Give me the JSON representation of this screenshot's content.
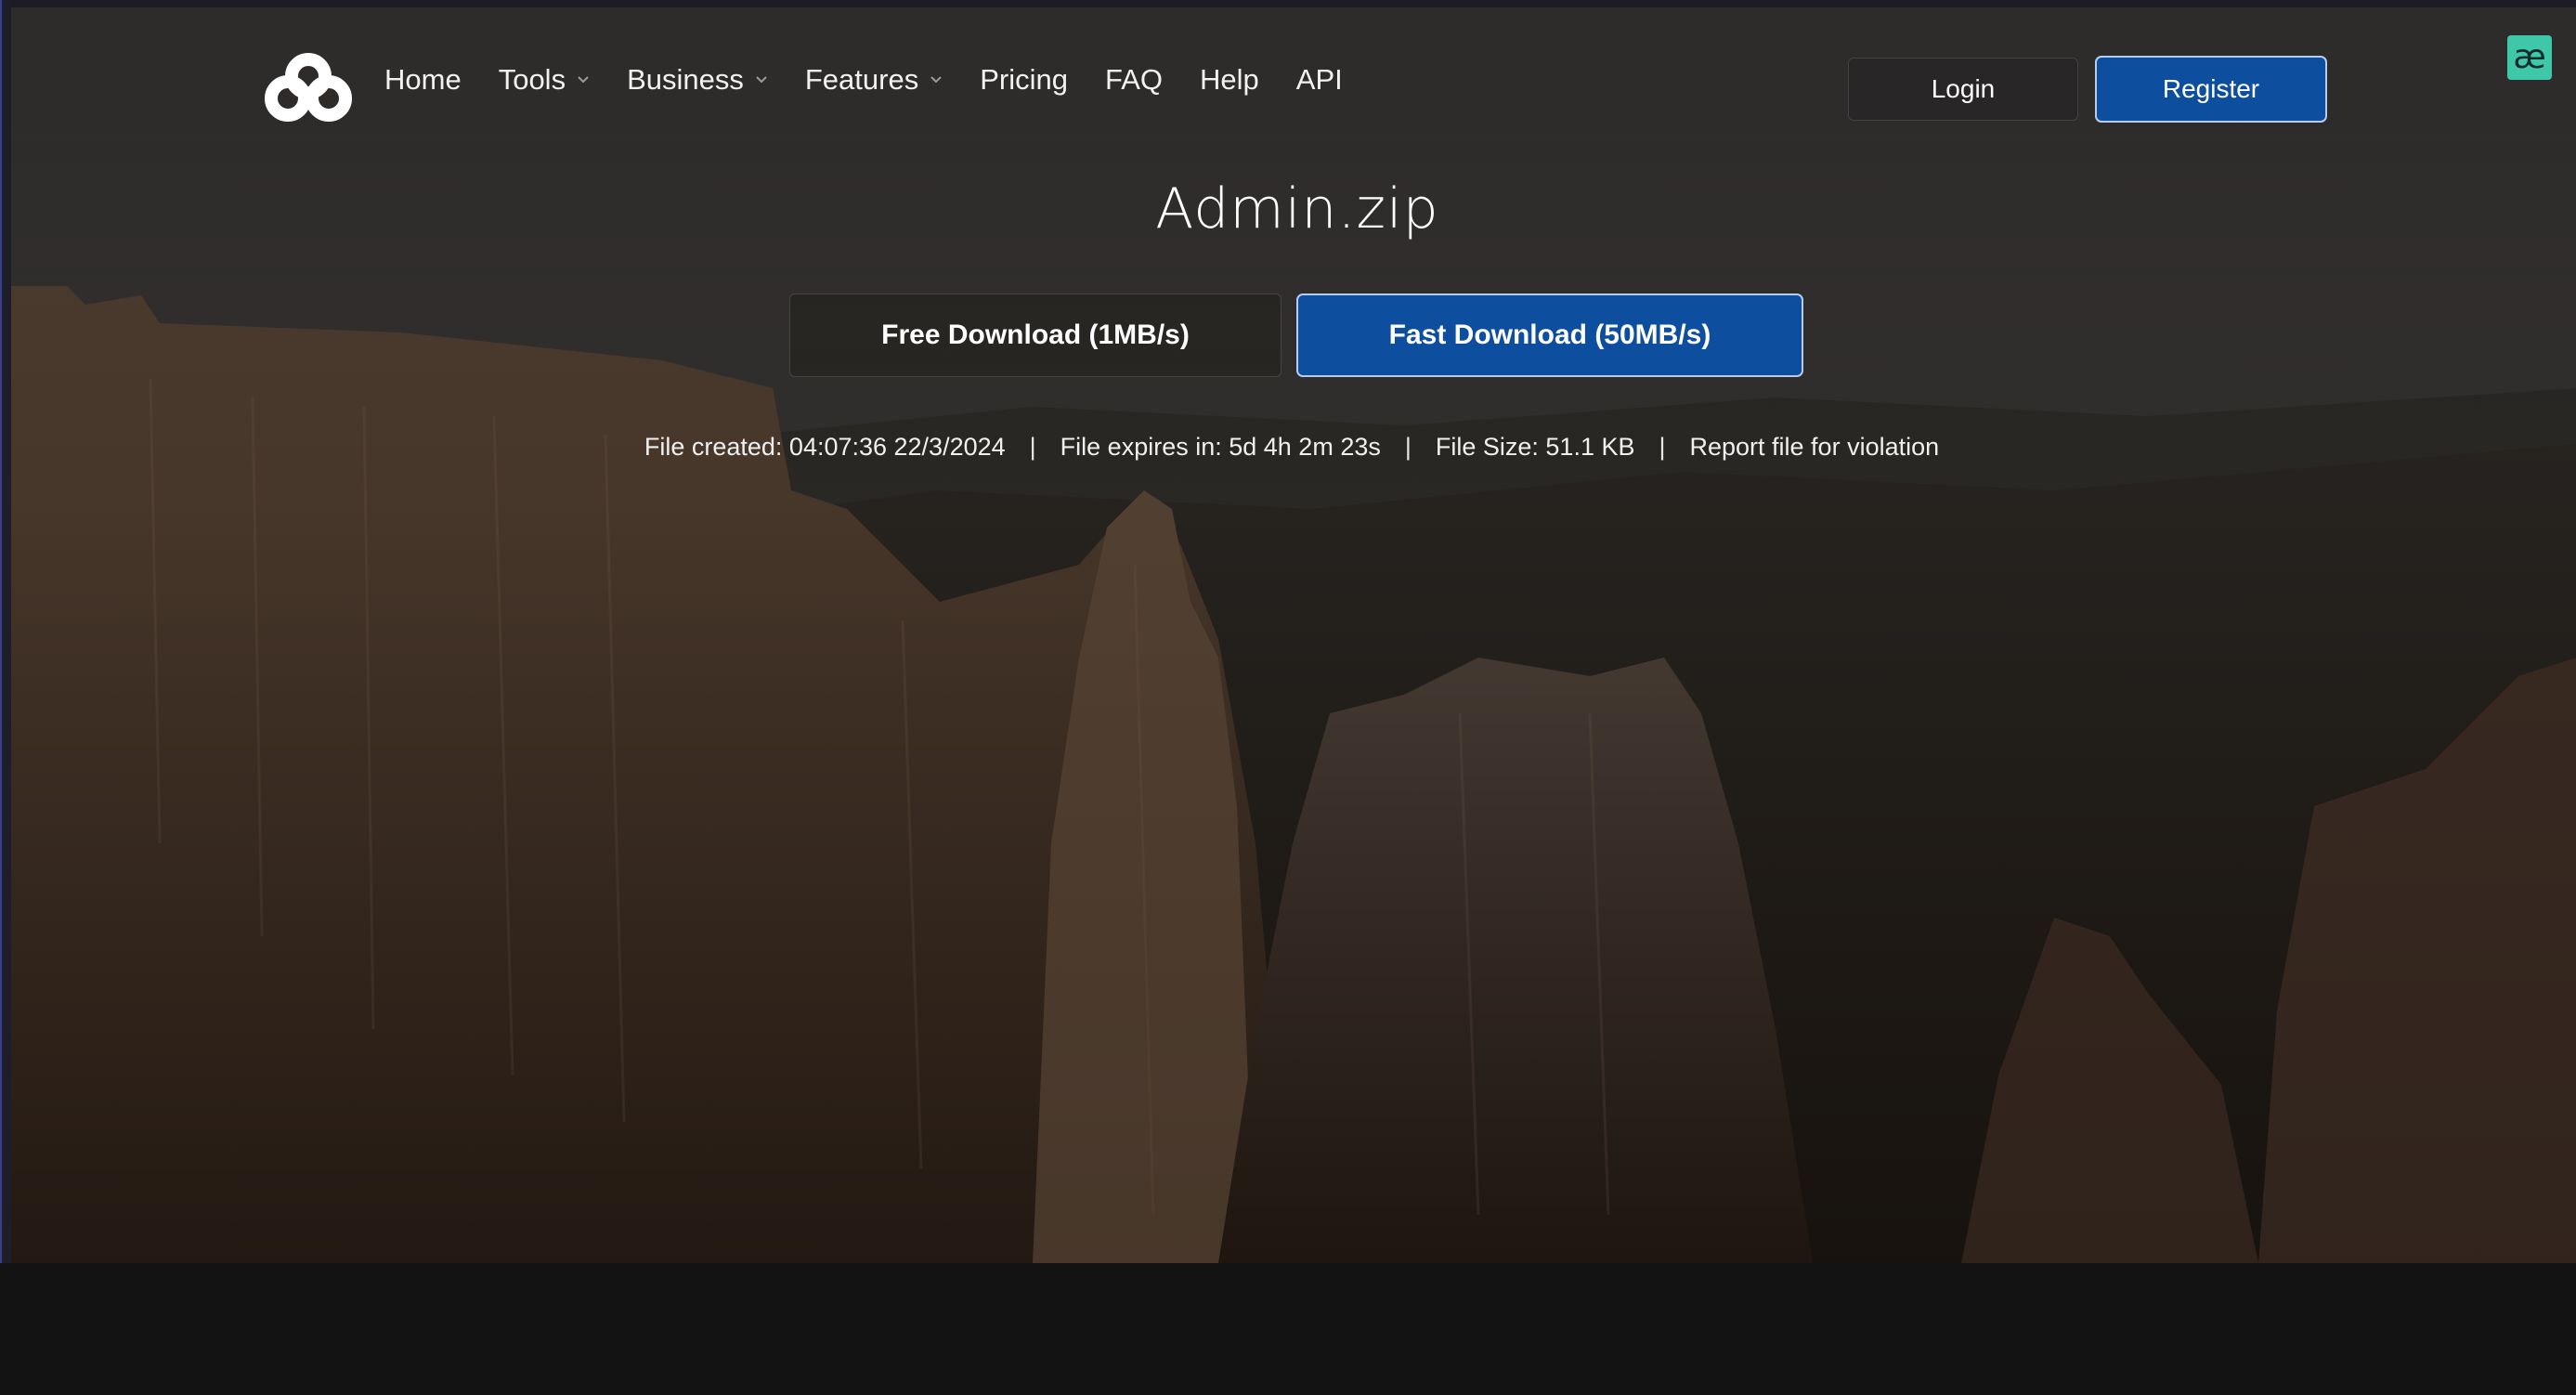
{
  "nav": {
    "items": [
      {
        "label": "Home",
        "dropdown": false
      },
      {
        "label": "Tools",
        "dropdown": true
      },
      {
        "label": "Business",
        "dropdown": true
      },
      {
        "label": "Features",
        "dropdown": true
      },
      {
        "label": "Pricing",
        "dropdown": false
      },
      {
        "label": "FAQ",
        "dropdown": false
      },
      {
        "label": "Help",
        "dropdown": false
      },
      {
        "label": "API",
        "dropdown": false
      }
    ],
    "login_label": "Login",
    "register_label": "Register"
  },
  "extension": {
    "glyph": "æ",
    "icon": "ae-extension-icon",
    "color": "#3fc7a9"
  },
  "file": {
    "name": "Admin.zip",
    "free_download_label": "Free Download (1MB/s)",
    "fast_download_label": "Fast Download (50MB/s)",
    "created": "File created: 04:07:36 22/3/2024",
    "expires": "File expires in: 5d 4h 2m 23s",
    "size": "File Size: 51.1 KB",
    "report_label": "Report file for violation",
    "separator": "|"
  },
  "colors": {
    "accent": "#0e4e9f",
    "accent_border": "#b8ccf0",
    "footer_bg": "#131313"
  }
}
